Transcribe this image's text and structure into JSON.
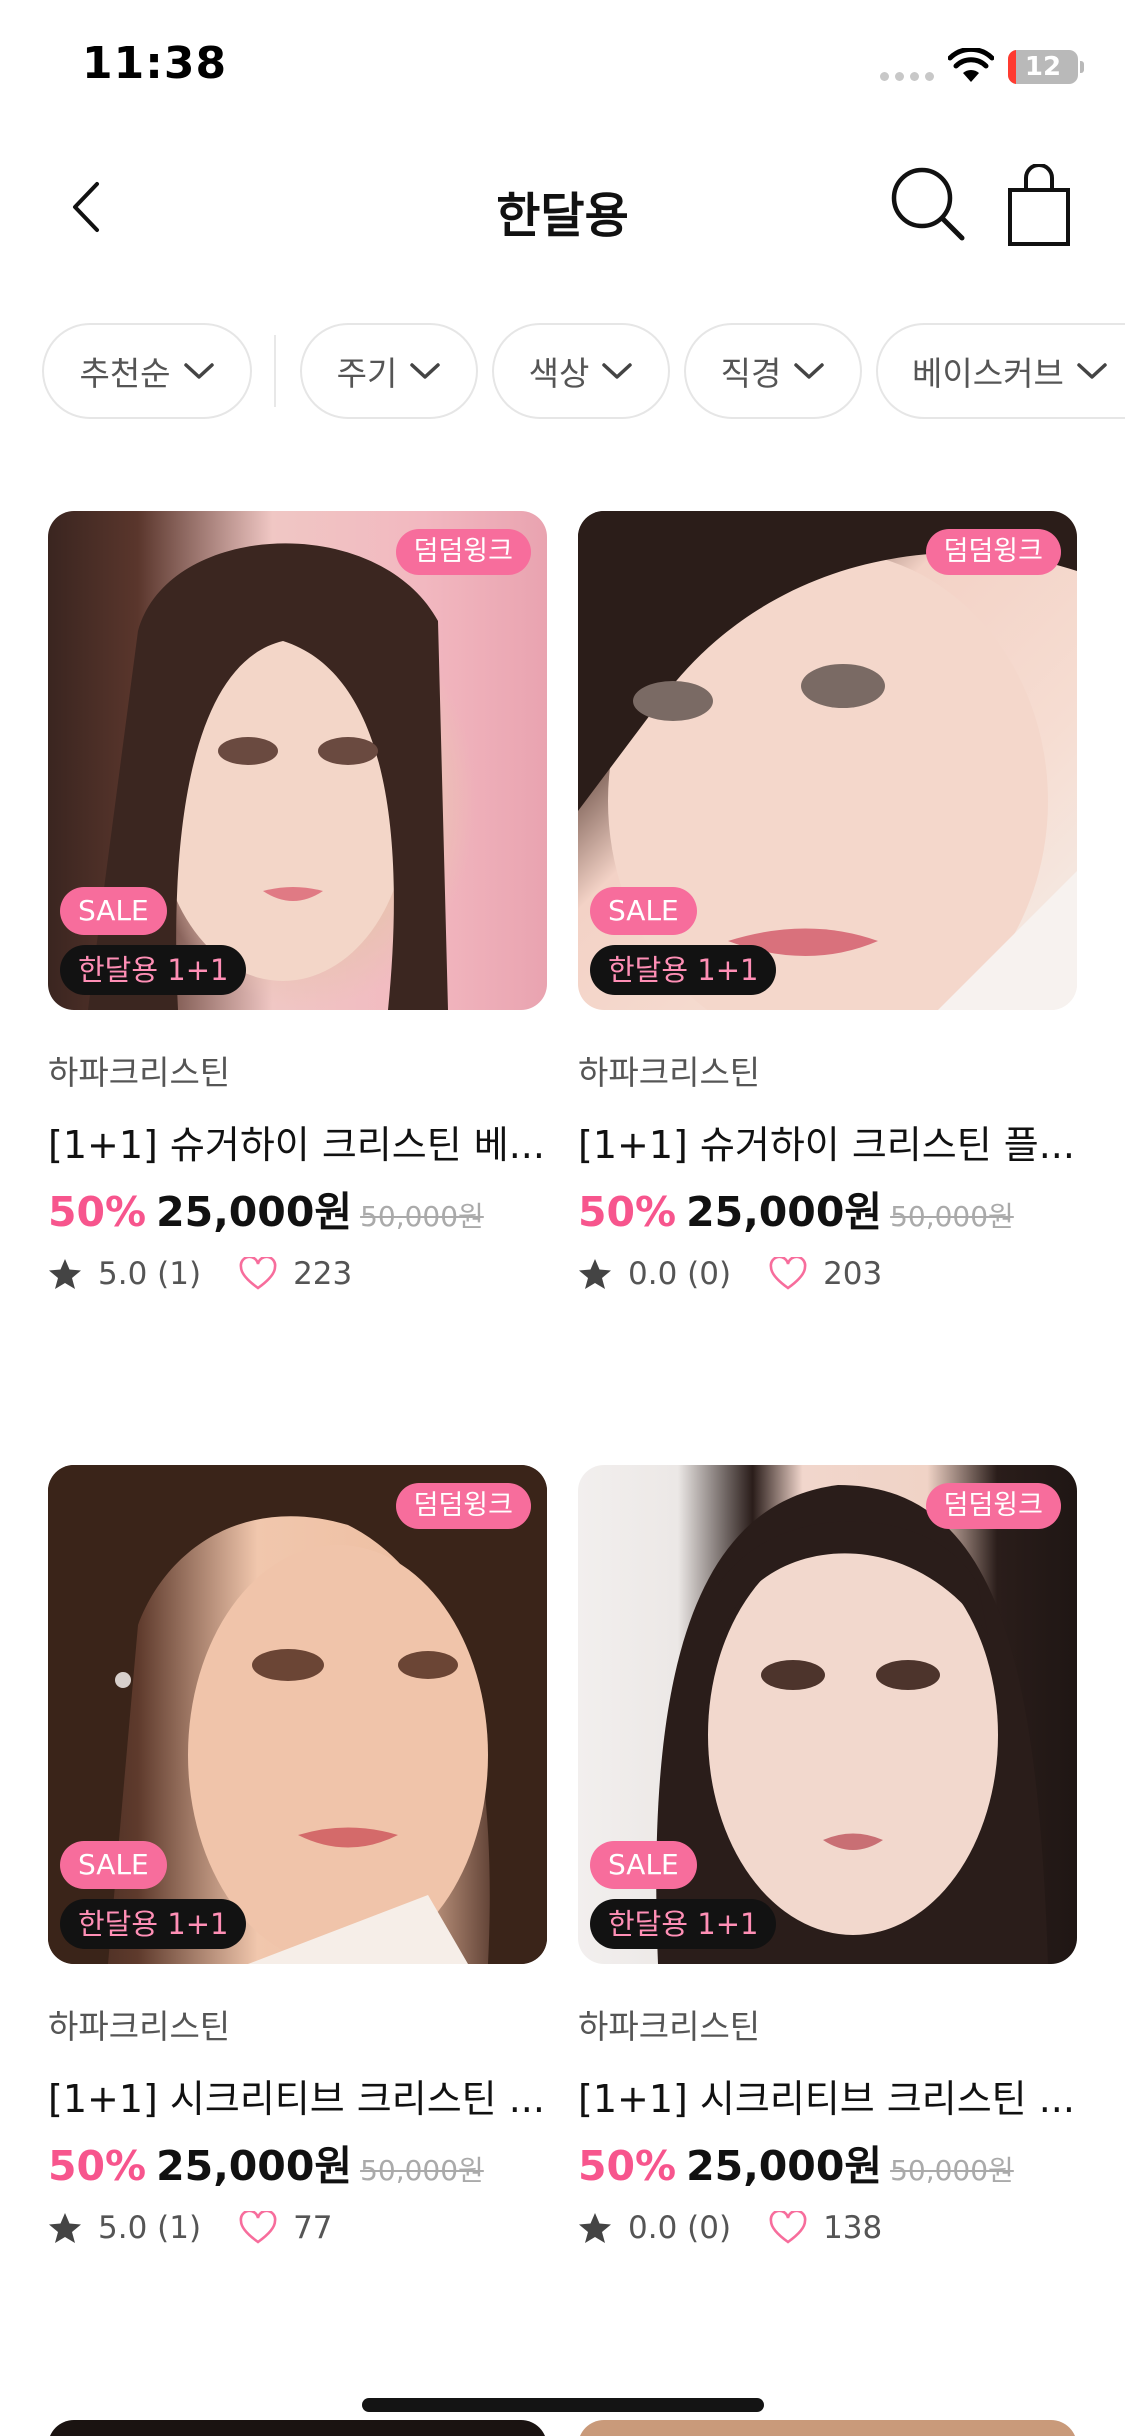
{
  "status_bar": {
    "time": "11:38",
    "battery": "12",
    "battery_level": 0.12
  },
  "header": {
    "title": "한달용",
    "back_icon": "chevron-left-icon",
    "search_icon": "search-icon",
    "cart_icon": "shopping-bag-icon"
  },
  "filters": [
    {
      "label": "추천순"
    },
    {
      "label": "주기"
    },
    {
      "label": "색상"
    },
    {
      "label": "직경"
    },
    {
      "label": "베이스커브"
    }
  ],
  "products": [
    {
      "badge": "덤덤윙크",
      "sale": "SALE",
      "promo": "한달용 1+1",
      "brand": "하파크리스틴",
      "title": "[1+1] 슈거하이 크리스틴 베...",
      "discount": "50%",
      "price": "25,000원",
      "original_price": "50,000원",
      "rating": "5.0 (1)",
      "likes": "223"
    },
    {
      "badge": "덤덤윙크",
      "sale": "SALE",
      "promo": "한달용 1+1",
      "brand": "하파크리스틴",
      "title": "[1+1] 슈거하이 크리스틴 플...",
      "discount": "50%",
      "price": "25,000원",
      "original_price": "50,000원",
      "rating": "0.0 (0)",
      "likes": "203"
    },
    {
      "badge": "덤덤윙크",
      "sale": "SALE",
      "promo": "한달용 1+1",
      "brand": "하파크리스틴",
      "title": "[1+1] 시크리티브 크리스틴 ...",
      "discount": "50%",
      "price": "25,000원",
      "original_price": "50,000원",
      "rating": "5.0 (1)",
      "likes": "77"
    },
    {
      "badge": "덤덤윙크",
      "sale": "SALE",
      "promo": "한달용 1+1",
      "brand": "하파크리스틴",
      "title": "[1+1] 시크리티브 크리스틴 ...",
      "discount": "50%",
      "price": "25,000원",
      "original_price": "50,000원",
      "rating": "0.0 (0)",
      "likes": "138"
    }
  ],
  "colors": {
    "accent": "#f76d9c",
    "discount": "#f7558d",
    "promo_text": "#ff8fb6"
  }
}
